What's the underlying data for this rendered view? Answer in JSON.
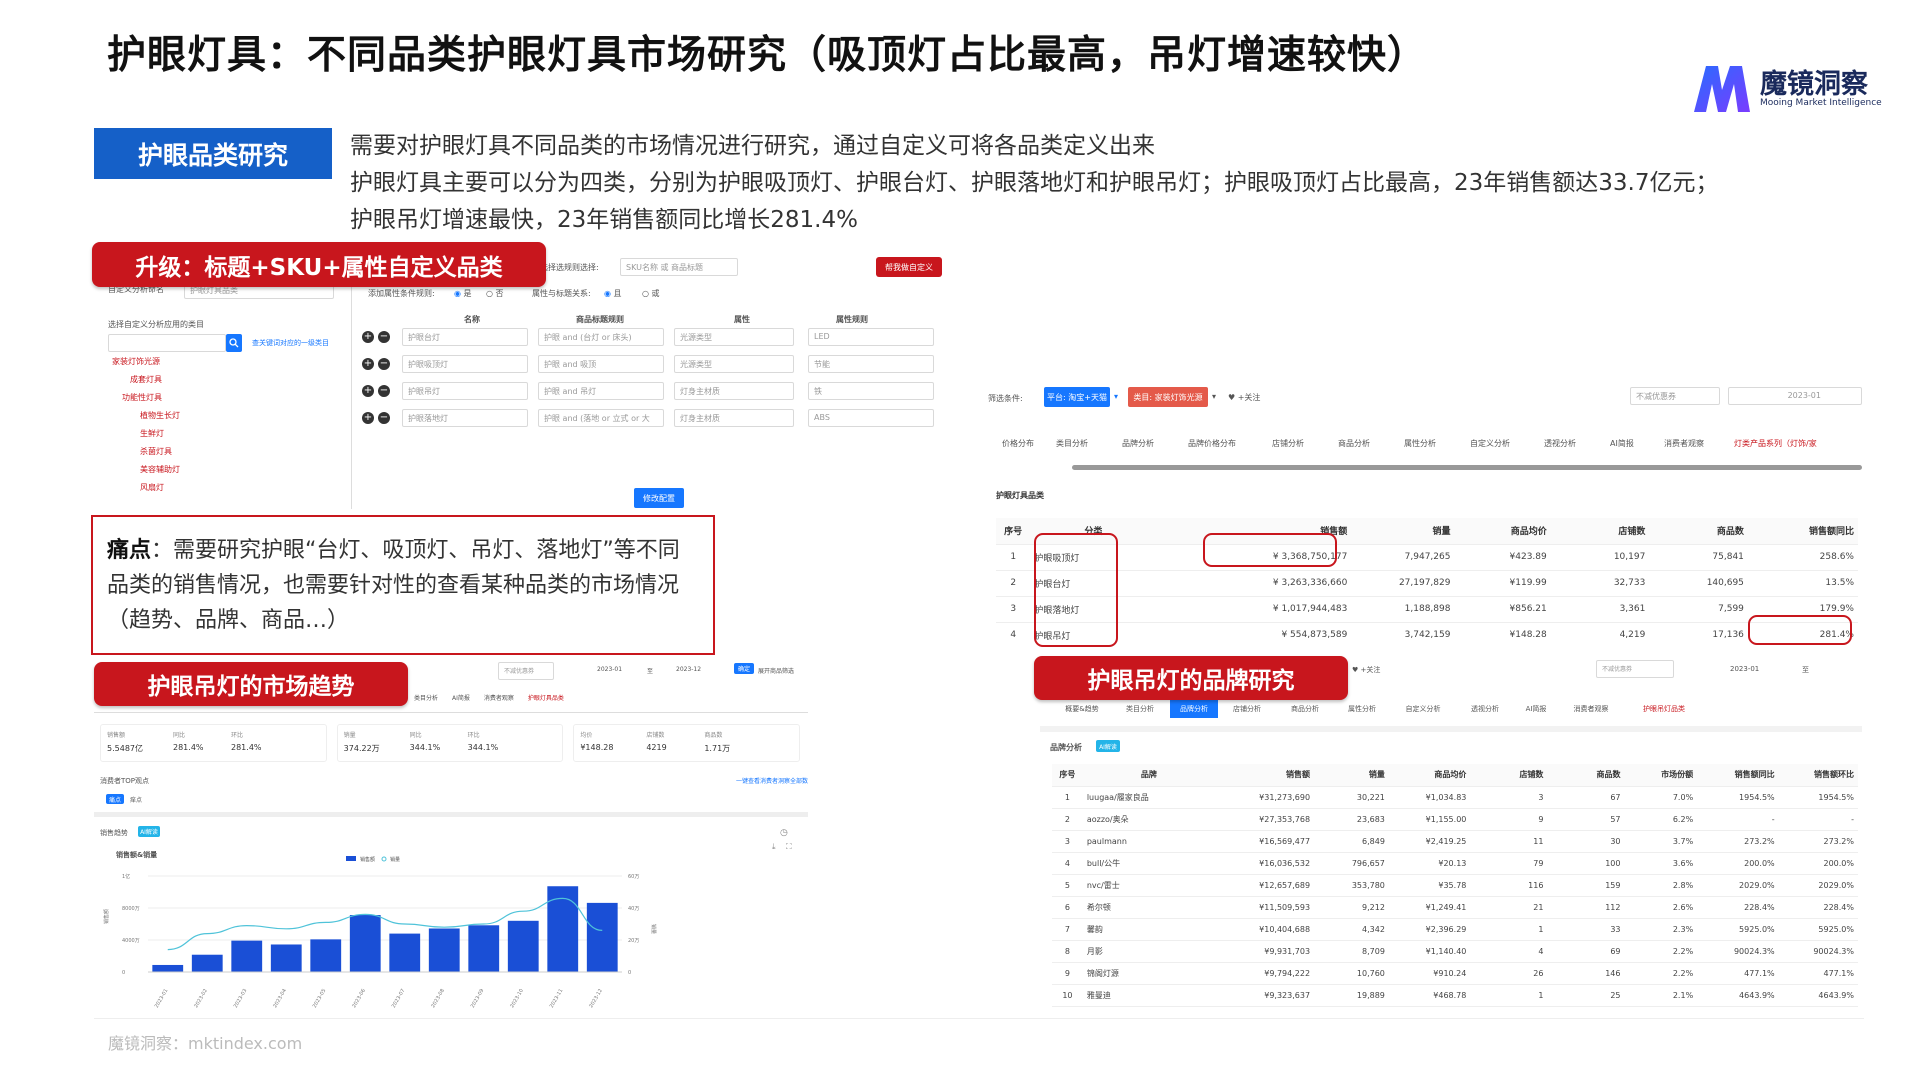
{
  "title": "护眼灯具：不同品类护眼灯具市场研究（吸顶灯占比最高，吊灯增速较快）",
  "logo": {
    "name": "魔镜洞察",
    "en": "Mooing Market Intelligence"
  },
  "section_tag": "护眼品类研究",
  "intro": [
    "需要对护眼灯具不同品类的市场情况进行研究，通过自定义可将各品类定义出来",
    "护眼灯具主要可以分为四类，分别为护眼吸顶灯、护眼台灯、护眼落地灯和护眼吊灯；护眼吸顶灯占比最高，23年销售额达33.7亿元；",
    "护眼吊灯增速最快，23年销售额同比增长281.4%"
  ],
  "banners": {
    "upgrade": "升级：标题+SKU+属性自定义品类",
    "trend": "护眼吊灯的市场趋势",
    "brand": "护眼吊灯的品牌研究"
  },
  "pain": {
    "label": "痛点",
    "text": "：需要研究护眼“台灯、吸顶灯、吊灯、落地灯”等不同品类的销售情况，也需要针对性的查看某种品类的市场情况（趋势、品牌、商品…）"
  },
  "footer": "魔镜洞察：mktindex.com",
  "config": {
    "name_label": "自定义分析命名",
    "name_value": "护眼灯具品类",
    "rule_label": "请选择选规则选择:",
    "rule_value": "SKU名称 或 商品标题",
    "add_button": "帮我做自定义",
    "cond_label": "添加属性条件规则:",
    "yes": "是",
    "no": "否",
    "rel_label": "属性与标题关系:",
    "and": "且",
    "or": "或",
    "apply_label": "选择自定义分析应用的类目",
    "search_hint": "查关键词对应的一级类目",
    "tree": [
      "家装灯饰光源",
      "成套灯具",
      "功能性灯具",
      "植物生长灯",
      "生鲜灯",
      "杀菌灯具",
      "美容辅助灯",
      "风扇灯"
    ],
    "cols": [
      "名称",
      "商品标题规则",
      "属性",
      "属性规则"
    ],
    "rows": [
      [
        "护眼台灯",
        "护眼 and (台灯 or 床头)",
        "光源类型",
        "LED"
      ],
      [
        "护眼吸顶灯",
        "护眼 and 吸顶",
        "光源类型",
        "节能"
      ],
      [
        "护眼吊灯",
        "护眼 and 吊灯",
        "灯身主材质",
        "铁"
      ],
      [
        "护眼落地灯",
        "护眼 and (落地 or 立式 or 大",
        "灯身主材质",
        "ABS"
      ]
    ],
    "modify_button": "修改配置"
  },
  "category": {
    "filter_label": "筛选条件:",
    "platform": "平台: 淘宝+天猫",
    "cat_tag": "类目: 家装灯饰光源",
    "follow": "+关注",
    "discount": "不减优惠券",
    "date": "2023-01",
    "tabs": [
      "价格分布",
      "类目分析",
      "品牌分析",
      "品牌价格分布",
      "店铺分析",
      "商品分析",
      "属性分析",
      "自定义分析",
      "透视分析",
      "AI简报",
      "消费者观察",
      "灯类产品系列（灯饰/家"
    ],
    "section": "护眼灯具品类",
    "cols": [
      "序号",
      "分类",
      "销售额",
      "销量",
      "商品均价",
      "店铺数",
      "商品数",
      "销售额同比"
    ],
    "rows": [
      [
        "1",
        "护眼吸顶灯",
        "¥ 3,368,750,177",
        "7,947,265",
        "¥423.89",
        "10,197",
        "75,841",
        "258.6%"
      ],
      [
        "2",
        "护眼台灯",
        "¥ 3,263,336,660",
        "27,197,829",
        "¥119.99",
        "32,733",
        "140,695",
        "13.5%"
      ],
      [
        "3",
        "护眼落地灯",
        "¥ 1,017,944,483",
        "1,188,898",
        "¥856.21",
        "3,361",
        "7,599",
        "179.9%"
      ],
      [
        "4",
        "护眼吊灯",
        "¥ 554,873,589",
        "3,742,159",
        "¥148.28",
        "4,219",
        "17,136",
        "281.4%"
      ]
    ]
  },
  "trend": {
    "discount": "不减优惠券",
    "d1": "2023-01",
    "to": "至",
    "d2": "2023-12",
    "confirm": "确定",
    "export": "展开商品筛选",
    "tabs": [
      "类目分析",
      "AI简报",
      "消费者观察",
      "护眼灯具品类"
    ],
    "stats": [
      {
        "k1": "销售额",
        "v1": "5.5487亿",
        "k2": "同比",
        "v2": "281.4%",
        "k3": "环比",
        "v3": "281.4%"
      },
      {
        "k1": "销量",
        "v1": "374.22万",
        "k2": "同比",
        "v2": "344.1%",
        "k3": "环比",
        "v3": "344.1%"
      },
      {
        "k1": "均价",
        "v1": "¥148.28",
        "k2": "店铺数",
        "v2": "4219",
        "k3": "商品数",
        "v3": "1.71万"
      }
    ],
    "consumer": "消费者TOP观点",
    "more_link": "一键查看消费者洞察全部数据",
    "mini_tabs": [
      "痛点",
      "痒点"
    ],
    "chart_label": "销售趋势",
    "ai_tag": "AI解读",
    "chart_title": "销售额&销量",
    "legend": [
      "销售额",
      "销量"
    ],
    "yleft_label": "销售额",
    "yright_label": "销量"
  },
  "chart_data": {
    "type": "bar",
    "categories": [
      "2023-01",
      "2023-02",
      "2023-03",
      "2023-04",
      "2023-05",
      "2023-06",
      "2023-07",
      "2023-08",
      "2023-09",
      "2023-10",
      "2023-11",
      "2023-12"
    ],
    "series": [
      {
        "name": "销售额",
        "values": [
          1100,
          2700,
          4900,
          4300,
          5100,
          8900,
          6000,
          6800,
          7300,
          8000,
          13400,
          10800
        ]
      },
      {
        "name": "销量",
        "values": [
          14,
          24,
          29,
          27,
          31,
          36,
          30,
          28,
          30,
          38,
          46,
          26
        ]
      }
    ],
    "y_left_ticks": [
      "1亿",
      "8000万",
      "4000万",
      "0"
    ],
    "y_right_ticks": [
      "60万",
      "40万",
      "20万",
      "0"
    ],
    "ylim_left": [
      0,
      15000
    ],
    "ylim_right": [
      0,
      60
    ]
  },
  "brand": {
    "follow": "+关注",
    "discount": "不减优惠券",
    "date": "2023-01",
    "to": "至",
    "tabs": [
      "概要&趋势",
      "类目分析",
      "品牌分析",
      "店铺分析",
      "商品分析",
      "属性分析",
      "自定义分析",
      "透视分析",
      "AI简报",
      "消费者观察",
      "护眼吊灯品类"
    ],
    "section": "品牌分析",
    "ai_tag": "AI解读",
    "cols": [
      "序号",
      "品牌",
      "销售额",
      "销量",
      "商品均价",
      "店铺数",
      "商品数",
      "市场份额",
      "销售额同比",
      "销售额环比"
    ],
    "rows": [
      [
        "1",
        "luugaa/履家良品",
        "¥31,273,690",
        "30,221",
        "¥1,034.83",
        "3",
        "67",
        "7.0%",
        "1954.5%",
        "1954.5%"
      ],
      [
        "2",
        "aozzo/奥朵",
        "¥27,353,768",
        "23,683",
        "¥1,155.00",
        "9",
        "57",
        "6.2%",
        "-",
        "-"
      ],
      [
        "3",
        "paulmann",
        "¥16,569,477",
        "6,849",
        "¥2,419.25",
        "11",
        "30",
        "3.7%",
        "273.2%",
        "273.2%"
      ],
      [
        "4",
        "bull/公牛",
        "¥16,036,532",
        "796,657",
        "¥20.13",
        "79",
        "100",
        "3.6%",
        "200.0%",
        "200.0%"
      ],
      [
        "5",
        "nvc/雷士",
        "¥12,657,689",
        "353,780",
        "¥35.78",
        "116",
        "159",
        "2.8%",
        "2029.0%",
        "2029.0%"
      ],
      [
        "6",
        "希尔顿",
        "¥11,509,593",
        "9,212",
        "¥1,249.41",
        "21",
        "112",
        "2.6%",
        "228.4%",
        "228.4%"
      ],
      [
        "7",
        "馨韵",
        "¥10,404,688",
        "4,342",
        "¥2,396.29",
        "1",
        "33",
        "2.3%",
        "5925.0%",
        "5925.0%"
      ],
      [
        "8",
        "月影",
        "¥9,931,703",
        "8,709",
        "¥1,140.40",
        "4",
        "69",
        "2.2%",
        "90024.3%",
        "90024.3%"
      ],
      [
        "9",
        "锦阁灯源",
        "¥9,794,222",
        "10,760",
        "¥910.24",
        "26",
        "146",
        "2.2%",
        "477.1%",
        "477.1%"
      ],
      [
        "10",
        "雅曼迪",
        "¥9,323,637",
        "19,889",
        "¥468.78",
        "1",
        "25",
        "2.1%",
        "4643.9%",
        "4643.9%"
      ]
    ]
  }
}
